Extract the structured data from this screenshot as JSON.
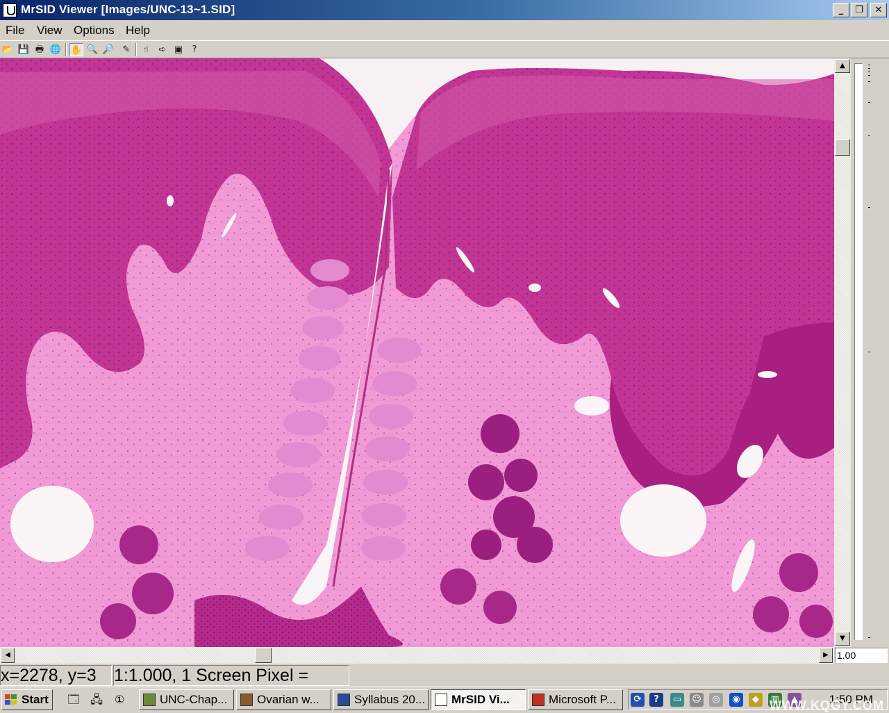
{
  "window": {
    "title": "MrSID Viewer [Images/UNC-13~1.SID]",
    "controls": {
      "minimize": "_",
      "restore": "❐",
      "close": "✕"
    }
  },
  "menu": [
    "File",
    "View",
    "Options",
    "Help"
  ],
  "toolbar": {
    "group1": [
      {
        "icon": "open-folder-icon",
        "glyph": "📂"
      },
      {
        "icon": "save-icon",
        "glyph": "💾"
      },
      {
        "icon": "print-icon",
        "glyph": "🖶"
      },
      {
        "icon": "globe-icon",
        "glyph": "🌐"
      }
    ],
    "group2": [
      {
        "icon": "pan-hand-icon",
        "glyph": "✋",
        "pressed": true
      },
      {
        "icon": "zoom-in-icon",
        "glyph": "🔍"
      },
      {
        "icon": "zoom-out-icon",
        "glyph": "🔎"
      },
      {
        "icon": "pencil-icon",
        "glyph": "✎"
      }
    ],
    "group3": [
      {
        "icon": "pointer-icon",
        "glyph": "☝"
      },
      {
        "icon": "arrow-right-icon",
        "glyph": "➪"
      },
      {
        "icon": "camera-icon",
        "glyph": "▣"
      },
      {
        "icon": "help-icon",
        "glyph": "?"
      }
    ]
  },
  "scrollbars": {
    "up_arrow": "▲",
    "down_arrow": "▼",
    "left_arrow": "◀",
    "right_arrow": "▶"
  },
  "zoom": {
    "value": "1.00"
  },
  "status": {
    "coordinates": "x=2278, y=3",
    "scale": "1:1.000,  1 Screen Pixel ="
  },
  "taskbar": {
    "start_label": "Start",
    "quick_launch": [
      {
        "icon": "desktop-icon",
        "glyph": "🗔"
      },
      {
        "icon": "network-icon",
        "glyph": "🖧"
      },
      {
        "icon": "app-icon",
        "glyph": "①"
      }
    ],
    "tasks": [
      {
        "label": "UNC-Chap...",
        "icon_color": "#6a8a3a",
        "active": false
      },
      {
        "label": "Ovarian w...",
        "icon_color": "#8a5a2a",
        "active": false
      },
      {
        "label": "Syllabus 20...",
        "icon_color": "#2a4a9a",
        "active": false
      },
      {
        "label": "MrSID Vi...",
        "icon_color": "#ffffff",
        "active": true
      },
      {
        "label": "Microsoft P...",
        "icon_color": "#c03020",
        "active": false
      }
    ],
    "tray_icons": [
      {
        "icon": "sync-icon",
        "glyph": "⟳",
        "color": "#2050b0"
      },
      {
        "icon": "help-tray-icon",
        "glyph": "?",
        "color": "#1a3a8a"
      },
      {
        "icon": "monitor-icon",
        "glyph": "▭",
        "color": "#3a8a8a"
      },
      {
        "icon": "people-icon",
        "glyph": "☺",
        "color": "#8a8a8a"
      },
      {
        "icon": "cd-icon",
        "glyph": "◎",
        "color": "#a0a0a0"
      },
      {
        "icon": "network-tray-icon",
        "glyph": "◉",
        "color": "#1050c0"
      },
      {
        "icon": "shield-icon",
        "glyph": "◆",
        "color": "#c0a020"
      },
      {
        "icon": "chart-tray-icon",
        "glyph": "▥",
        "color": "#3a7a3a"
      },
      {
        "icon": "bag-icon",
        "glyph": "▲",
        "color": "#8a50a0"
      }
    ],
    "clock": "1:50 PM",
    "watermark": "WWW.KQGY.COM"
  }
}
